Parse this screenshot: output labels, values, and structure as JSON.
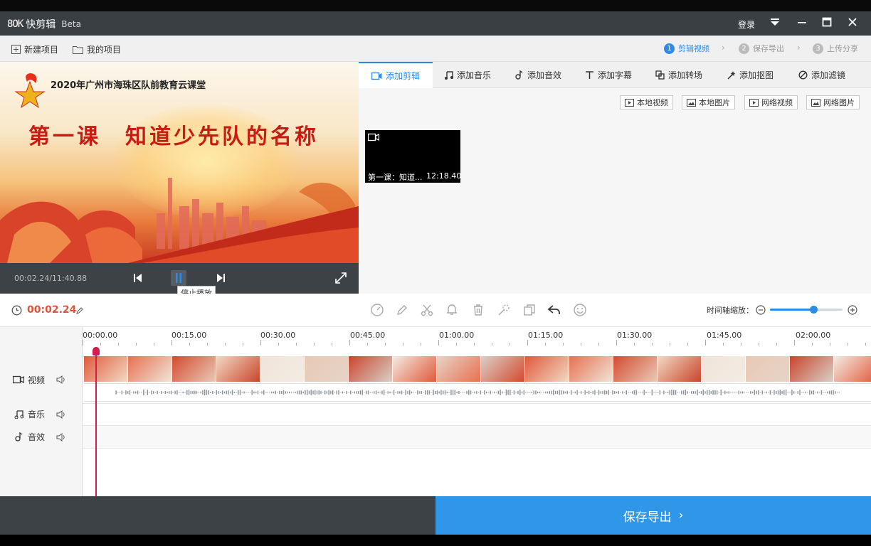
{
  "app": {
    "logo_mark": "8OK",
    "name": "快剪辑",
    "beta": "Beta"
  },
  "titlebar": {
    "login": "登录"
  },
  "toolbar": {
    "new_project": "新建项目",
    "my_projects": "我的项目",
    "steps": [
      {
        "num": "1",
        "label": "剪辑视频"
      },
      {
        "num": "2",
        "label": "保存导出"
      },
      {
        "num": "3",
        "label": "上传分享"
      }
    ]
  },
  "preview": {
    "header_text": "2020年广州市海珠区队前教育云课堂",
    "lesson_title": "第一课　知道少先队的名称",
    "time": "00:02.24/11:40.88",
    "tooltip": "停止播放"
  },
  "tabs": [
    "添加剪辑",
    "添加音乐",
    "添加音效",
    "添加字幕",
    "添加转场",
    "添加抠图",
    "添加滤镜"
  ],
  "sources": [
    "本地视频",
    "本地图片",
    "网络视频",
    "网络图片"
  ],
  "clip": {
    "name": "第一课：知道...",
    "duration": "12:18.40"
  },
  "timeline": {
    "current_time": "00:02.24",
    "zoom_label": "时间轴缩放：",
    "zoom_level": 0.6,
    "ruler": [
      "00:00.00",
      "00:15.00",
      "00:30.00",
      "00:45.00",
      "01:00.00",
      "01:15.00",
      "01:30.00",
      "01:45.00",
      "02:00.00"
    ],
    "tracks": {
      "video": "视频",
      "music": "音乐",
      "effects": "音效"
    }
  },
  "export": {
    "label": "保存导出"
  },
  "colors": {
    "accent": "#2a8ce8",
    "time": "#e0533a",
    "playhead": "#d41e4a"
  }
}
